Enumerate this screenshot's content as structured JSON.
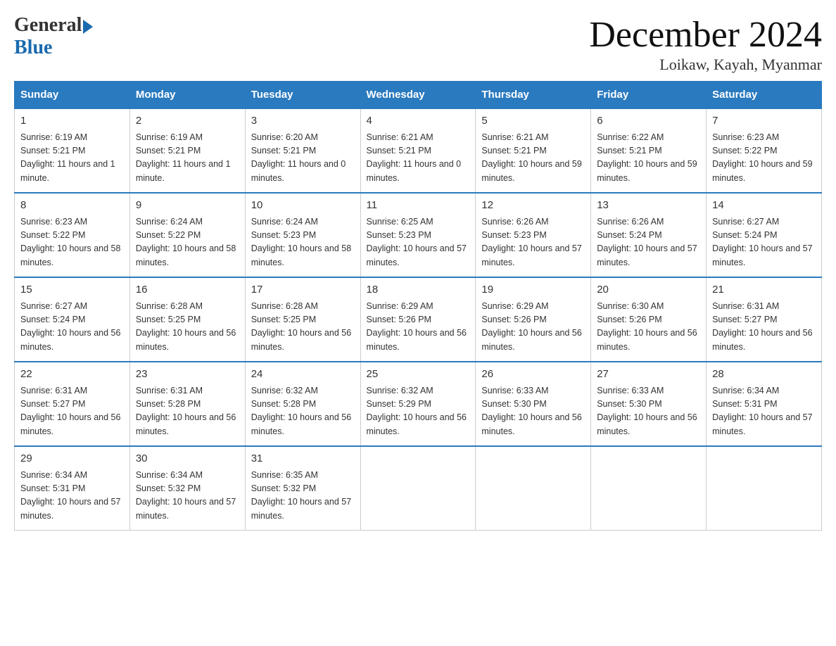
{
  "header": {
    "logo_general": "General",
    "logo_blue": "Blue",
    "month_title": "December 2024",
    "location": "Loikaw, Kayah, Myanmar"
  },
  "days_of_week": [
    "Sunday",
    "Monday",
    "Tuesday",
    "Wednesday",
    "Thursday",
    "Friday",
    "Saturday"
  ],
  "weeks": [
    [
      {
        "day": "1",
        "sunrise": "6:19 AM",
        "sunset": "5:21 PM",
        "daylight": "11 hours and 1 minute."
      },
      {
        "day": "2",
        "sunrise": "6:19 AM",
        "sunset": "5:21 PM",
        "daylight": "11 hours and 1 minute."
      },
      {
        "day": "3",
        "sunrise": "6:20 AM",
        "sunset": "5:21 PM",
        "daylight": "11 hours and 0 minutes."
      },
      {
        "day": "4",
        "sunrise": "6:21 AM",
        "sunset": "5:21 PM",
        "daylight": "11 hours and 0 minutes."
      },
      {
        "day": "5",
        "sunrise": "6:21 AM",
        "sunset": "5:21 PM",
        "daylight": "10 hours and 59 minutes."
      },
      {
        "day": "6",
        "sunrise": "6:22 AM",
        "sunset": "5:21 PM",
        "daylight": "10 hours and 59 minutes."
      },
      {
        "day": "7",
        "sunrise": "6:23 AM",
        "sunset": "5:22 PM",
        "daylight": "10 hours and 59 minutes."
      }
    ],
    [
      {
        "day": "8",
        "sunrise": "6:23 AM",
        "sunset": "5:22 PM",
        "daylight": "10 hours and 58 minutes."
      },
      {
        "day": "9",
        "sunrise": "6:24 AM",
        "sunset": "5:22 PM",
        "daylight": "10 hours and 58 minutes."
      },
      {
        "day": "10",
        "sunrise": "6:24 AM",
        "sunset": "5:23 PM",
        "daylight": "10 hours and 58 minutes."
      },
      {
        "day": "11",
        "sunrise": "6:25 AM",
        "sunset": "5:23 PM",
        "daylight": "10 hours and 57 minutes."
      },
      {
        "day": "12",
        "sunrise": "6:26 AM",
        "sunset": "5:23 PM",
        "daylight": "10 hours and 57 minutes."
      },
      {
        "day": "13",
        "sunrise": "6:26 AM",
        "sunset": "5:24 PM",
        "daylight": "10 hours and 57 minutes."
      },
      {
        "day": "14",
        "sunrise": "6:27 AM",
        "sunset": "5:24 PM",
        "daylight": "10 hours and 57 minutes."
      }
    ],
    [
      {
        "day": "15",
        "sunrise": "6:27 AM",
        "sunset": "5:24 PM",
        "daylight": "10 hours and 56 minutes."
      },
      {
        "day": "16",
        "sunrise": "6:28 AM",
        "sunset": "5:25 PM",
        "daylight": "10 hours and 56 minutes."
      },
      {
        "day": "17",
        "sunrise": "6:28 AM",
        "sunset": "5:25 PM",
        "daylight": "10 hours and 56 minutes."
      },
      {
        "day": "18",
        "sunrise": "6:29 AM",
        "sunset": "5:26 PM",
        "daylight": "10 hours and 56 minutes."
      },
      {
        "day": "19",
        "sunrise": "6:29 AM",
        "sunset": "5:26 PM",
        "daylight": "10 hours and 56 minutes."
      },
      {
        "day": "20",
        "sunrise": "6:30 AM",
        "sunset": "5:26 PM",
        "daylight": "10 hours and 56 minutes."
      },
      {
        "day": "21",
        "sunrise": "6:31 AM",
        "sunset": "5:27 PM",
        "daylight": "10 hours and 56 minutes."
      }
    ],
    [
      {
        "day": "22",
        "sunrise": "6:31 AM",
        "sunset": "5:27 PM",
        "daylight": "10 hours and 56 minutes."
      },
      {
        "day": "23",
        "sunrise": "6:31 AM",
        "sunset": "5:28 PM",
        "daylight": "10 hours and 56 minutes."
      },
      {
        "day": "24",
        "sunrise": "6:32 AM",
        "sunset": "5:28 PM",
        "daylight": "10 hours and 56 minutes."
      },
      {
        "day": "25",
        "sunrise": "6:32 AM",
        "sunset": "5:29 PM",
        "daylight": "10 hours and 56 minutes."
      },
      {
        "day": "26",
        "sunrise": "6:33 AM",
        "sunset": "5:30 PM",
        "daylight": "10 hours and 56 minutes."
      },
      {
        "day": "27",
        "sunrise": "6:33 AM",
        "sunset": "5:30 PM",
        "daylight": "10 hours and 56 minutes."
      },
      {
        "day": "28",
        "sunrise": "6:34 AM",
        "sunset": "5:31 PM",
        "daylight": "10 hours and 57 minutes."
      }
    ],
    [
      {
        "day": "29",
        "sunrise": "6:34 AM",
        "sunset": "5:31 PM",
        "daylight": "10 hours and 57 minutes."
      },
      {
        "day": "30",
        "sunrise": "6:34 AM",
        "sunset": "5:32 PM",
        "daylight": "10 hours and 57 minutes."
      },
      {
        "day": "31",
        "sunrise": "6:35 AM",
        "sunset": "5:32 PM",
        "daylight": "10 hours and 57 minutes."
      },
      null,
      null,
      null,
      null
    ]
  ],
  "labels": {
    "sunrise": "Sunrise:",
    "sunset": "Sunset:",
    "daylight": "Daylight:"
  }
}
